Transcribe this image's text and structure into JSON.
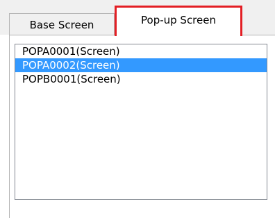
{
  "tabs": [
    {
      "label": "Base Screen",
      "selected": false
    },
    {
      "label": "Pop-up Screen",
      "selected": true
    }
  ],
  "highlight_color": "#e31e24",
  "selection_color": "#3399ff",
  "list": {
    "items": [
      {
        "label": "POPA0001(Screen)",
        "selected": false
      },
      {
        "label": "POPA0002(Screen)",
        "selected": true
      },
      {
        "label": "POPB0001(Screen)",
        "selected": false
      }
    ]
  }
}
